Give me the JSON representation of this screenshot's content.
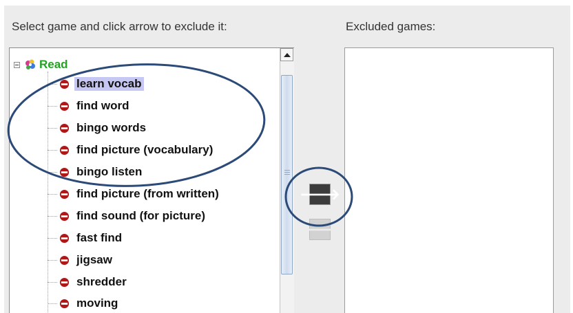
{
  "labels": {
    "select_instruction": "Select game and click arrow to exclude it:",
    "excluded_games": "Excluded games:"
  },
  "tree": {
    "root": {
      "label": "Read",
      "expanded": true,
      "icon": "activity-group-icon"
    },
    "items": [
      {
        "label": "learn vocab",
        "icon": "game-icon",
        "selected": true
      },
      {
        "label": "find word",
        "icon": "game-icon",
        "selected": false
      },
      {
        "label": "bingo words",
        "icon": "game-icon",
        "selected": false
      },
      {
        "label": "find picture (vocabulary)",
        "icon": "game-icon",
        "selected": false
      },
      {
        "label": "bingo listen",
        "icon": "game-icon",
        "selected": false
      },
      {
        "label": "find picture (from written)",
        "icon": "game-icon",
        "selected": false
      },
      {
        "label": "find sound (for picture)",
        "icon": "game-icon",
        "selected": false
      },
      {
        "label": "fast find",
        "icon": "game-icon",
        "selected": false
      },
      {
        "label": "jigsaw",
        "icon": "game-icon",
        "selected": false
      },
      {
        "label": "shredder",
        "icon": "game-icon",
        "selected": false
      },
      {
        "label": "moving",
        "icon": "game-icon",
        "selected": false
      }
    ]
  },
  "buttons": {
    "exclude": {
      "glyph": "🡒",
      "icon": "arrow-right-icon",
      "enabled": true
    },
    "include": {
      "glyph": "🡐",
      "icon": "arrow-left-icon",
      "enabled": false
    }
  },
  "excluded_list": {
    "items": []
  },
  "colors": {
    "root_label": "#22a322",
    "selection": "#c7c7f4",
    "annotation": "#2c4a78"
  }
}
